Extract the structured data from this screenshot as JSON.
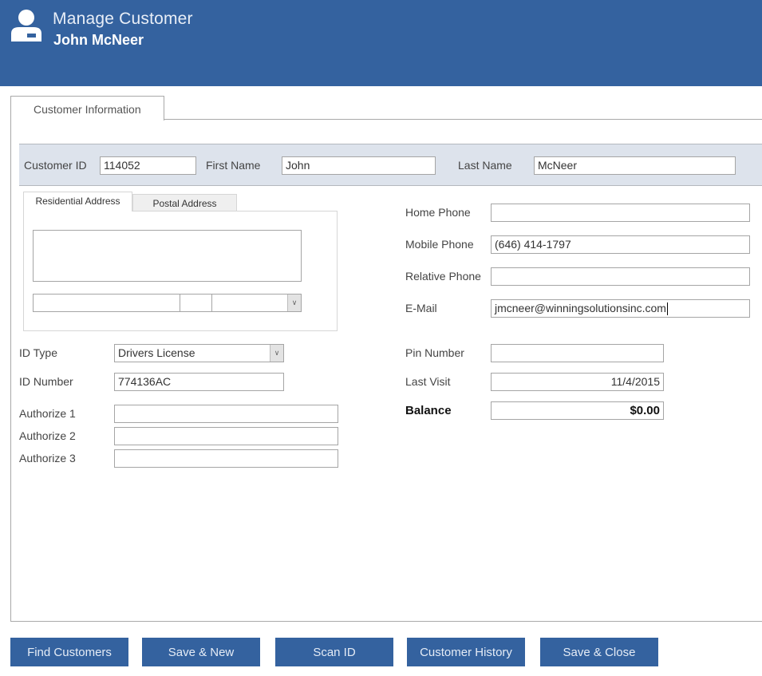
{
  "header": {
    "icon": "user-icon",
    "title": "Manage Customer",
    "subtitle": "John McNeer",
    "color": "#34629f"
  },
  "tabs": [
    {
      "label": "Customer Information",
      "active": true
    }
  ],
  "id_band": {
    "customer_id": {
      "label": "Customer ID",
      "value": "114052"
    },
    "first_name": {
      "label": "First Name",
      "value": "John"
    },
    "last_name": {
      "label": "Last Name",
      "value": "McNeer"
    }
  },
  "address": {
    "tabs": [
      {
        "label": "Residential Address",
        "active": true
      },
      {
        "label": "Postal Address",
        "active": false
      }
    ],
    "street": "",
    "city": "",
    "state": "",
    "zip": ""
  },
  "contact": {
    "home_phone": {
      "label": "Home Phone",
      "value": ""
    },
    "mobile_phone": {
      "label": "Mobile Phone",
      "value": "(646) 414-1797"
    },
    "relative_phone": {
      "label": "Relative Phone",
      "value": ""
    },
    "email": {
      "label": "E-Mail",
      "value": "jmcneer@winningsolutionsinc.com"
    }
  },
  "identity": {
    "id_type": {
      "label": "ID Type",
      "value": "Drivers License"
    },
    "id_number": {
      "label": "ID Number",
      "value": "774136AC"
    },
    "authorize1": {
      "label": "Authorize 1",
      "value": ""
    },
    "authorize2": {
      "label": "Authorize 2",
      "value": ""
    },
    "authorize3": {
      "label": "Authorize 3",
      "value": ""
    }
  },
  "account": {
    "pin_number": {
      "label": "Pin Number",
      "value": ""
    },
    "last_visit": {
      "label": "Last Visit",
      "value": "11/4/2015"
    },
    "balance": {
      "label": "Balance",
      "value": "$0.00"
    }
  },
  "buttons": {
    "find_customers": "Find Customers",
    "save_new": "Save & New",
    "scan_id": "Scan ID",
    "customer_history": "Customer History",
    "save_close": "Save & Close"
  }
}
